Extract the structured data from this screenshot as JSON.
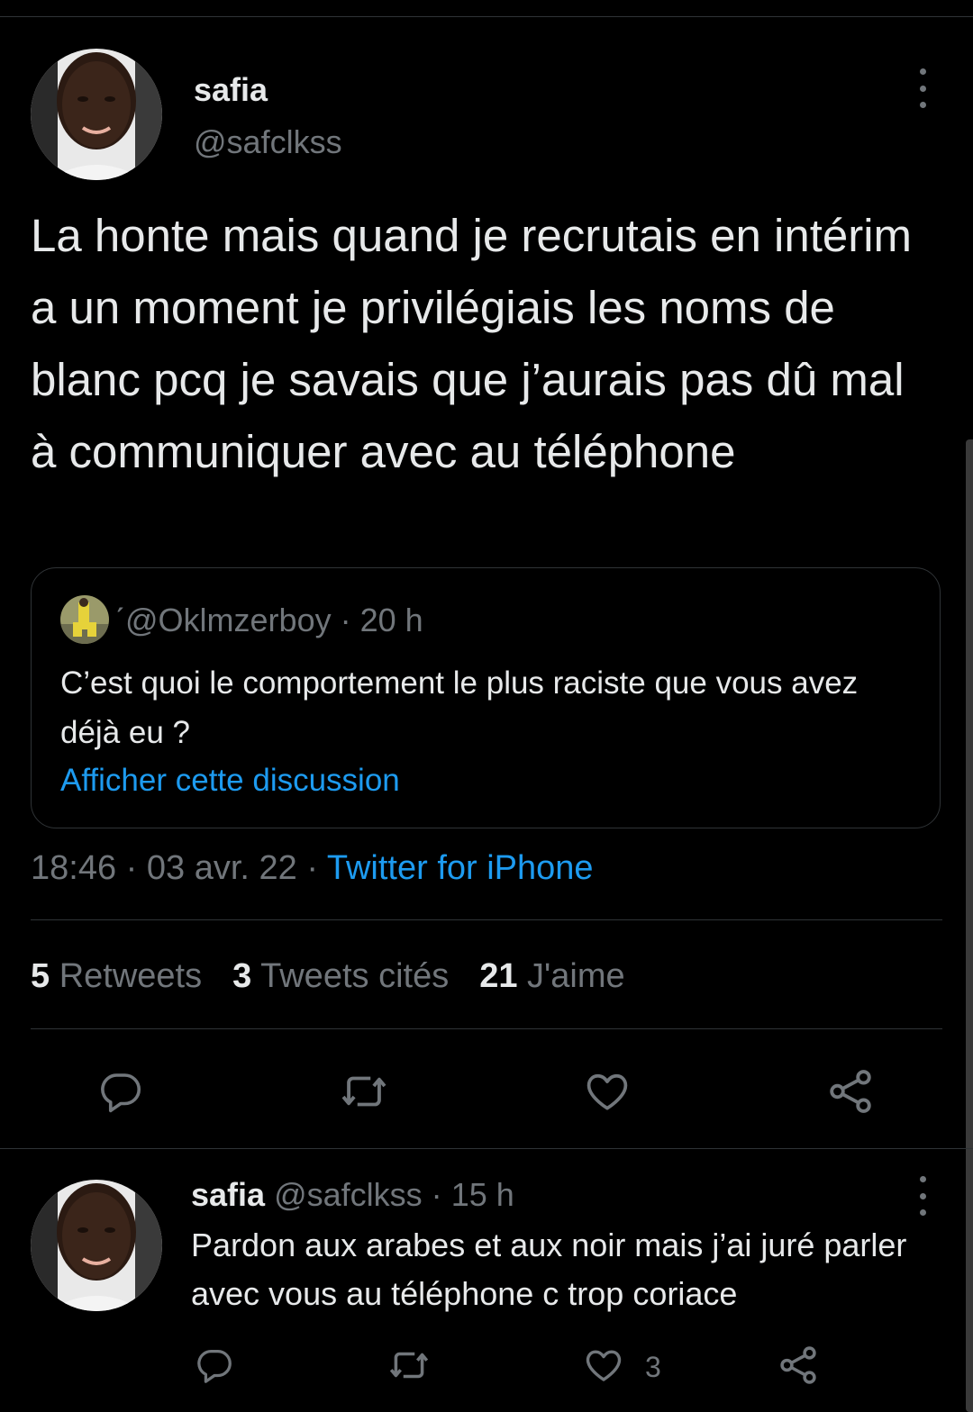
{
  "tweet": {
    "author_name": "safia",
    "author_handle": "@safclkss",
    "text": "La honte mais quand je recrutais en intérim a un moment je privilégiais les noms de blanc pcq je savais que j’aurais pas dû mal à communiquer avec au téléphone",
    "time": "18:46",
    "date": "03 avr. 22",
    "source": "Twitter for iPhone",
    "separator": "·",
    "stats": {
      "retweets_count": "5",
      "retweets_label": "Retweets",
      "quotes_count": "3",
      "quotes_label": "Tweets cités",
      "likes_count": "21",
      "likes_label": "J'aime"
    },
    "actions": [
      "reply-icon",
      "retweet-icon",
      "like-icon",
      "share-icon"
    ]
  },
  "quoted": {
    "name_mark": "ˊ",
    "handle": "@Oklmzerboy",
    "time": "20 h",
    "text": "C’est quoi le comportement le plus raciste que vous avez déjà eu ?",
    "link": "Afficher cette discussion"
  },
  "reply": {
    "author_name": "safia",
    "author_handle": "@safclkss",
    "time": "15 h",
    "text": "Pardon aux arabes et aux noir mais j’ai juré parler avec vous au téléphone c trop coriace",
    "like_count": "3"
  },
  "colors": {
    "background": "#000000",
    "text": "#e7e9ea",
    "muted": "#71767b",
    "accent": "#1d9bf0",
    "border": "#2f3336"
  }
}
